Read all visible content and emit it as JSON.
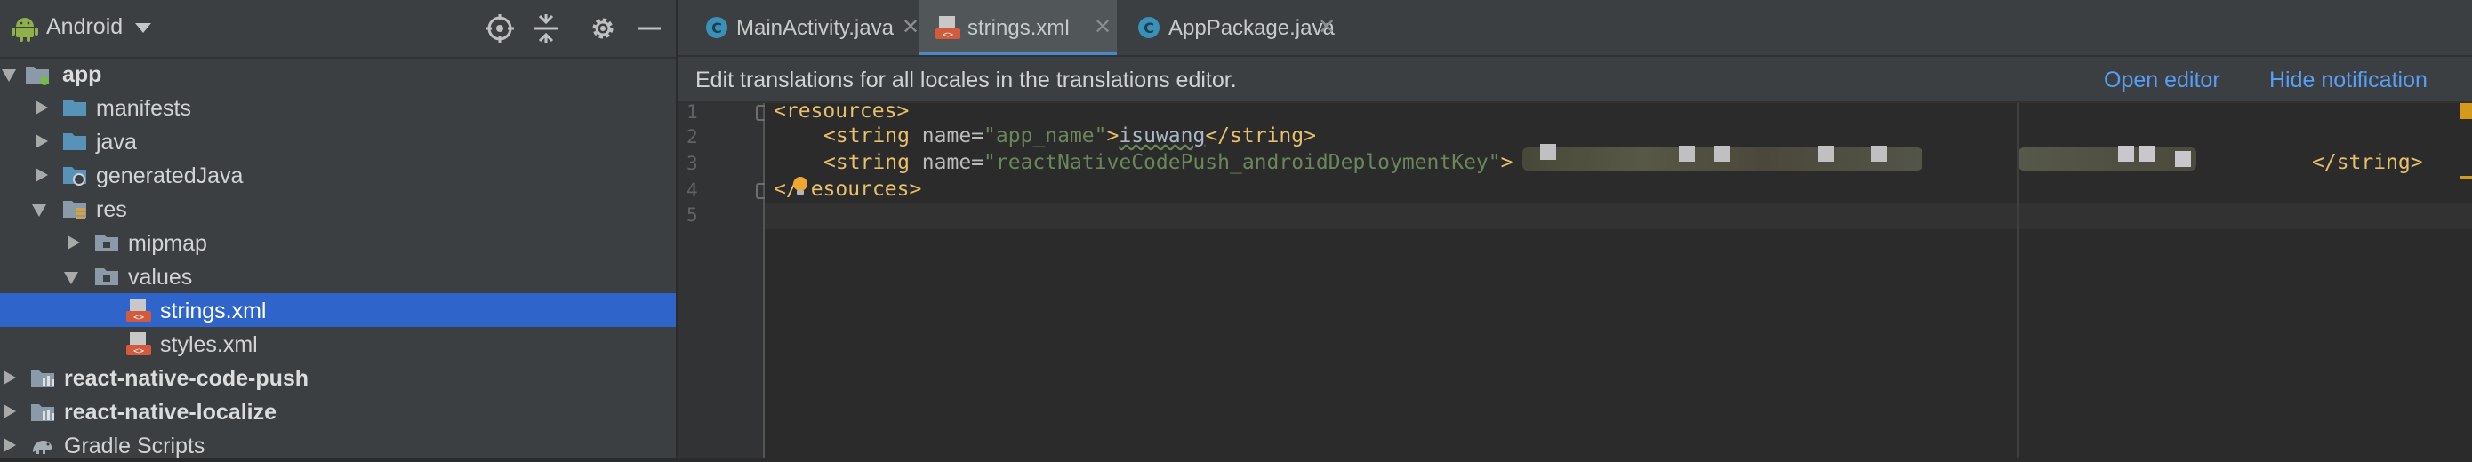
{
  "project_panel": {
    "view_mode": "Android",
    "tree": [
      {
        "label": "app",
        "level": 0,
        "expanded": true,
        "bold": true,
        "icon": "module-icon"
      },
      {
        "label": "manifests",
        "level": 1,
        "expanded": false,
        "icon": "folder-icon"
      },
      {
        "label": "java",
        "level": 1,
        "expanded": false,
        "icon": "folder-icon"
      },
      {
        "label": "generatedJava",
        "level": 1,
        "expanded": false,
        "icon": "generated-folder-icon"
      },
      {
        "label": "res",
        "level": 1,
        "expanded": true,
        "icon": "res-folder-icon"
      },
      {
        "label": "mipmap",
        "level": 2,
        "expanded": false,
        "icon": "folder-icon"
      },
      {
        "label": "values",
        "level": 2,
        "expanded": true,
        "icon": "folder-icon"
      },
      {
        "label": "strings.xml",
        "level": 3,
        "selected": true,
        "icon": "xml-file-icon"
      },
      {
        "label": "styles.xml",
        "level": 3,
        "icon": "xml-file-icon"
      },
      {
        "label": "react-native-code-push",
        "level": 0,
        "expanded": false,
        "bold": true,
        "icon": "library-module-icon"
      },
      {
        "label": "react-native-localize",
        "level": 0,
        "expanded": false,
        "bold": true,
        "icon": "library-module-icon"
      },
      {
        "label": "Gradle Scripts",
        "level": 0,
        "expanded": false,
        "icon": "gradle-icon"
      }
    ]
  },
  "tabs": [
    {
      "label": "MainActivity.java",
      "icon": "java-class-icon",
      "active": false
    },
    {
      "label": "strings.xml",
      "icon": "xml-file-icon",
      "active": true
    },
    {
      "label": "AppPackage.java",
      "icon": "java-class-icon",
      "active": false
    }
  ],
  "notification": {
    "text": "Edit translations for all locales in the translations editor.",
    "open_editor": "Open editor",
    "hide_notification": "Hide notification"
  },
  "editor": {
    "line_numbers": [
      "1",
      "2",
      "3",
      "4",
      "5"
    ],
    "lines": {
      "l1_open": "<resources>",
      "l2_open": "<string",
      "l2_attr": " name=",
      "l2_val": "\"app_name\"",
      "l2_gt": ">",
      "l2_text": "isuwang",
      "l2_close": "</string>",
      "l3_open": "<string",
      "l3_attr": " name=",
      "l3_val": "\"reactNativeCodePush_androidDeploymentKey\"",
      "l3_gt": ">",
      "l3_close": "</string>",
      "l4_close_a": "</",
      "l4_close_b": "esources>"
    }
  },
  "colors": {
    "selection": "#2f65ca",
    "link": "#589df6",
    "xml_tag": "#e8bf6a",
    "xml_value": "#6a8759"
  }
}
